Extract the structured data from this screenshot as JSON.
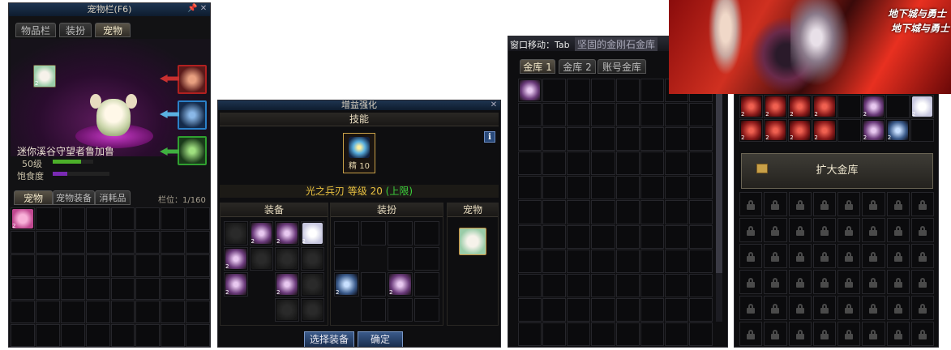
{
  "pet_window": {
    "title": "宠物栏(F6)",
    "tabs": [
      "物品栏",
      "装扮",
      "宠物"
    ],
    "active_tab": 2,
    "pet_name": "迷你溪谷守望者鲁加鲁",
    "level_label": "50级",
    "satiety_label": "饱食度",
    "level_progress": 0.7,
    "satiety_progress": 0.25,
    "pet_slot_badge": "2",
    "inv_tabs": [
      "宠物",
      "宠物装备",
      "消耗品"
    ],
    "capacity_label": "栏位：1/160",
    "item_badge": "2"
  },
  "enhance_window": {
    "title": "增益强化",
    "skill_header": "技能",
    "skill_level": "精 10",
    "skill_text": "光之兵刃 等级 20",
    "skill_limit": "(上限)",
    "col_equip": "装备",
    "col_avatar": "装扮",
    "col_pet": "宠物",
    "select_button": "选择装备",
    "confirm_button": "确定",
    "badge": "2"
  },
  "bank_window": {
    "title_prefix": "窗口移动：Tab",
    "title": "坚固的金刚石金库",
    "tabs": [
      "金库 1",
      "金库 2",
      "账号金库"
    ],
    "active_tab": 0
  },
  "expand_window": {
    "expand_button": "扩大金库",
    "badge": "2"
  },
  "banner": {
    "logo_line1": "地下城与勇士",
    "logo_line2": "地下城与勇士"
  },
  "colors": {
    "level_bar": "#4caf2a",
    "satiety_bar": "#7a2ab4",
    "limit_green": "#3cd23c",
    "skill_gold": "#e8c040"
  }
}
